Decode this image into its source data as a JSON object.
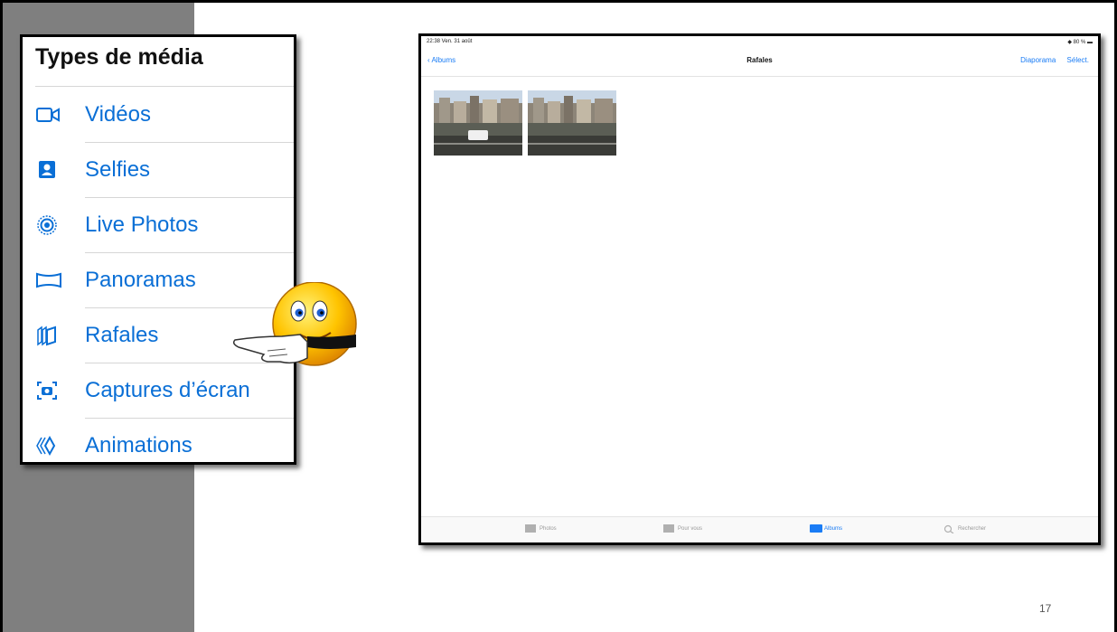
{
  "media_panel": {
    "title": "Types de média",
    "items": [
      {
        "label": "Vidéos",
        "icon": "video-camera-icon"
      },
      {
        "label": "Selfies",
        "icon": "selfie-portrait-icon"
      },
      {
        "label": "Live Photos",
        "icon": "live-photo-icon"
      },
      {
        "label": "Panoramas",
        "icon": "panorama-icon"
      },
      {
        "label": "Rafales",
        "icon": "burst-icon"
      },
      {
        "label": "Captures d’écran",
        "icon": "screenshot-icon"
      },
      {
        "label": "Animations",
        "icon": "animation-icon"
      }
    ]
  },
  "ipad": {
    "status_time": "22:38  Ven. 31 août",
    "status_right": "80 %",
    "nav": {
      "back_label": "Albums",
      "title": "Rafales",
      "action_slideshow": "Diaporama",
      "action_select": "Sélect."
    },
    "tabs": [
      {
        "label": "Photos",
        "icon": "photos-tab-icon",
        "active": false
      },
      {
        "label": "Pour vous",
        "icon": "for-you-tab-icon",
        "active": false
      },
      {
        "label": "Albums",
        "icon": "albums-tab-icon",
        "active": true
      },
      {
        "label": "Rechercher",
        "icon": "search-icon",
        "active": false
      }
    ]
  },
  "page_number": "17",
  "colors": {
    "ios_blue": "#0a6fd6",
    "gray_strip": "#7f7f7f"
  }
}
